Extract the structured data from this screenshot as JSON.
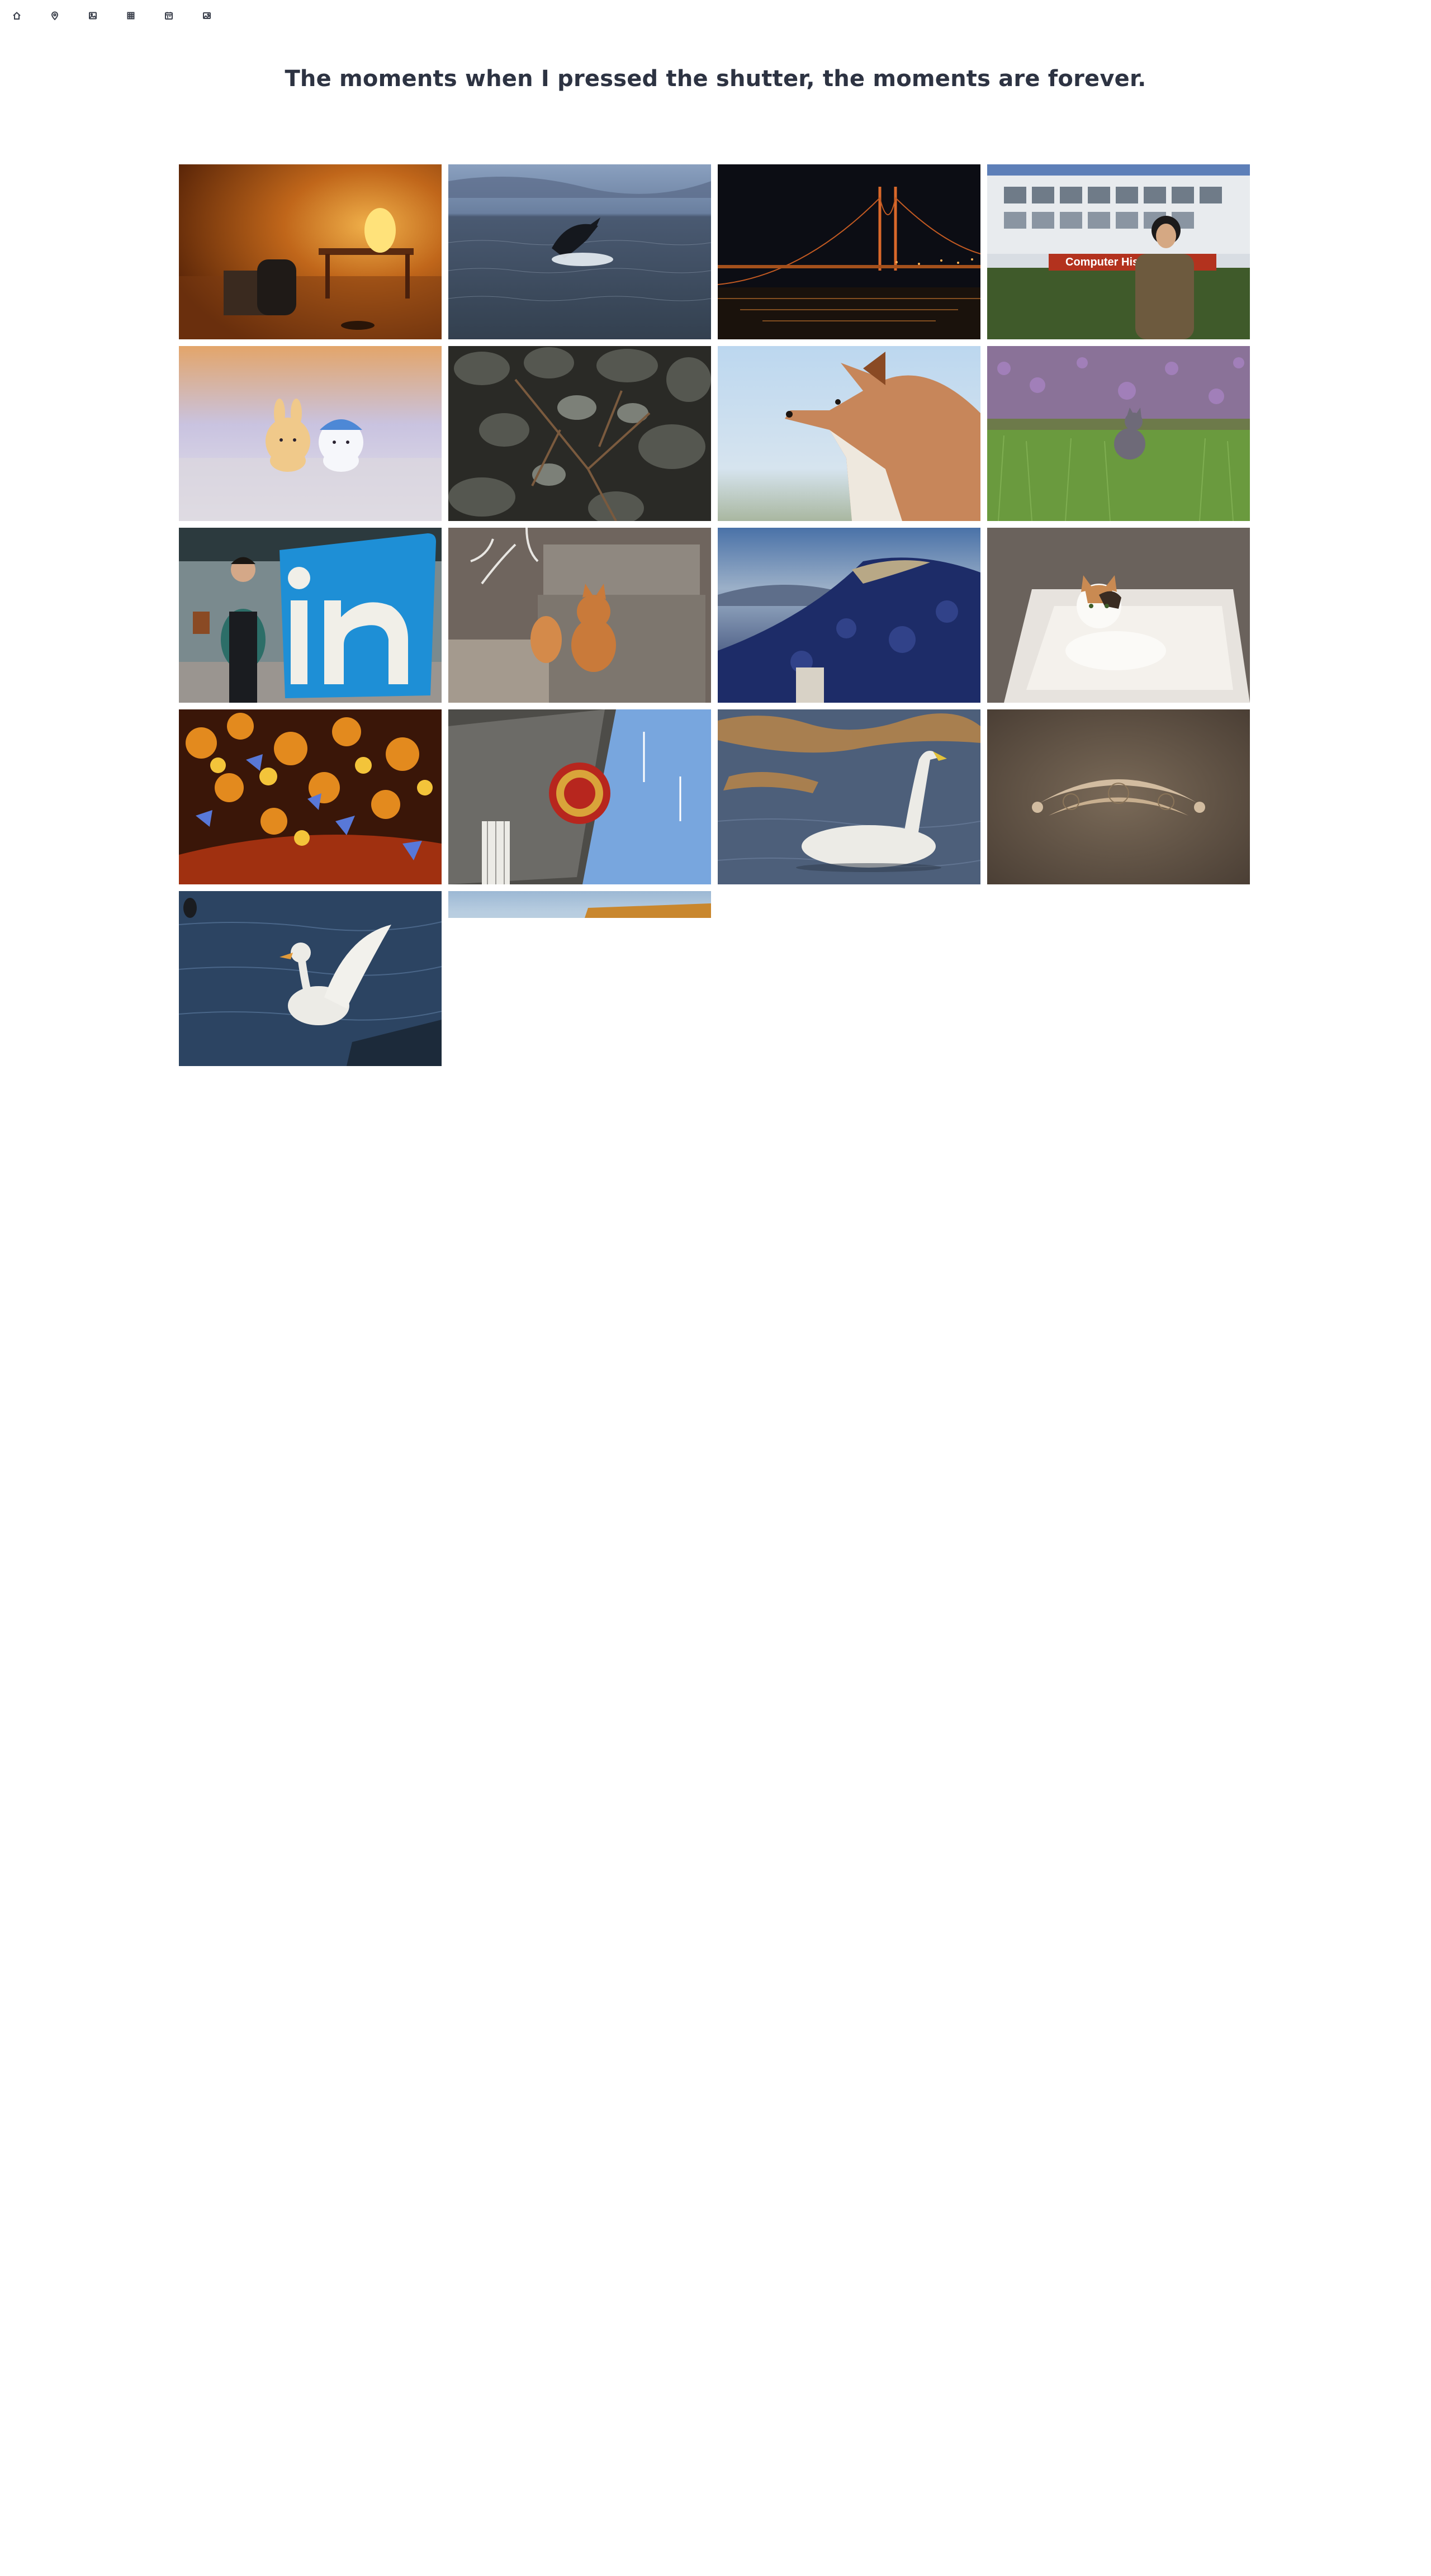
{
  "nav": {
    "icons": [
      "home-icon",
      "map-pin-icon",
      "image-icon",
      "grid-icon",
      "calendar-icon",
      "picture-icon"
    ]
  },
  "header": {
    "headline": "The moments when I pressed the shutter, the moments are forever."
  },
  "gallery": {
    "photos": [
      {
        "subject": "lamp-on-table"
      },
      {
        "subject": "whale-breaching"
      },
      {
        "subject": "golden-gate-night"
      },
      {
        "subject": "computer-history-museum",
        "sign_text": "Computer Histo"
      },
      {
        "subject": "plush-toys"
      },
      {
        "subject": "rocks-and-branches"
      },
      {
        "subject": "fox-profile"
      },
      {
        "subject": "cat-in-grass"
      },
      {
        "subject": "linkedin-sign"
      },
      {
        "subject": "cat-on-stones"
      },
      {
        "subject": "hill-landscape"
      },
      {
        "subject": "calico-kitten"
      },
      {
        "subject": "ornate-ceiling"
      },
      {
        "subject": "emblem-building"
      },
      {
        "subject": "swan-on-water"
      },
      {
        "subject": "carved-ornament"
      },
      {
        "subject": "duck-spreading-wings"
      },
      {
        "subject": "rooftop-partial"
      }
    ]
  }
}
